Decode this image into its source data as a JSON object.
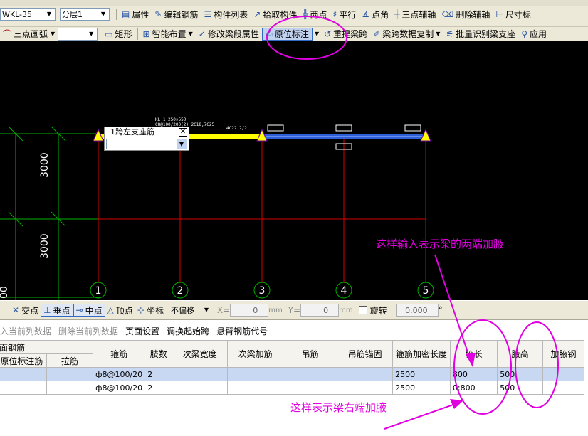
{
  "toolbar1": {
    "floor_select": "WKL-35",
    "layer_select": "分层1",
    "buttons": {
      "properties": "属性",
      "edit_rebar": "编辑钢筋",
      "component_list": "构件列表",
      "pick_component": "拾取构件",
      "two_points": "两点",
      "parallel": "平行",
      "point_angle": "点角",
      "three_point_aux": "三点辅轴",
      "delete_aux": "删除辅轴",
      "dimension": "尺寸标"
    }
  },
  "toolbar2": {
    "arc_tool": "三点画弧",
    "arc_select": "",
    "rect": "矩形",
    "smart_layout": "智能布置",
    "modify_beam_props": "修改梁段属性",
    "in_situ_annotation": "原位标注",
    "reextract_span": "重提梁跨",
    "copy_span_data": "梁跨数据复制",
    "batch_identify": "批量识别梁支座",
    "apply": "应用"
  },
  "canvas": {
    "dim_top": "3000",
    "dim_bottom": "3000",
    "dim_edge": "00",
    "axis_labels": [
      "1",
      "2",
      "3",
      "4",
      "5"
    ],
    "beam_text_1": "KL 1 250×550",
    "beam_text_2": "C8@100/200(2) 2C18;7C25",
    "beam_text_3": "4C22 2/2",
    "popup_title": "1跨左支座筋",
    "popup_value": ""
  },
  "snapbar": {
    "intersection": "交点",
    "perpendicular": "垂点",
    "midpoint": "中点",
    "vertex": "顶点",
    "coordinate": "坐标",
    "offset_mode": "不偏移",
    "x_label": "X=",
    "x_value": "0",
    "y_label": "Y=",
    "y_value": "0",
    "unit": "mm",
    "rotate_label": "旋转",
    "rotate_value": "0.000",
    "degree": "°"
  },
  "panel_tools": {
    "insert_column": "入当前列数据",
    "delete_column": "删除当前列数据",
    "page_setup": "页面设置",
    "swap_span": "调换起始跨",
    "cantilever_code": "悬臂钢筋代号"
  },
  "table": {
    "group_header": "面钢筋",
    "sub_headers": [
      "原位标注筋",
      "拉筋"
    ],
    "headers": [
      "箍筋",
      "肢数",
      "次梁宽度",
      "次梁加筋",
      "吊筋",
      "吊筋锚固",
      "箍筋加密长度",
      "腋长",
      "腋高",
      "加腋钢"
    ],
    "rows": [
      [
        "",
        "",
        "ф8@100/20",
        "2",
        "",
        "",
        "",
        "",
        "2500",
        "800",
        "500",
        ""
      ],
      [
        "",
        "",
        "ф8@100/20",
        "2",
        "",
        "",
        "",
        "",
        "2500",
        "0;800",
        "500",
        ""
      ]
    ]
  },
  "annotations": {
    "both_ends": "这样输入表示梁的两端加腋",
    "right_end": "这样表示梁右端加腋"
  },
  "colors": {
    "highlight": "#e000e0",
    "canvas_bg": "#000000",
    "grid_red": "#d40000",
    "grid_green": "#00b000",
    "beam_yellow": "#ffff00",
    "beam_blue": "#2f5fd8"
  }
}
